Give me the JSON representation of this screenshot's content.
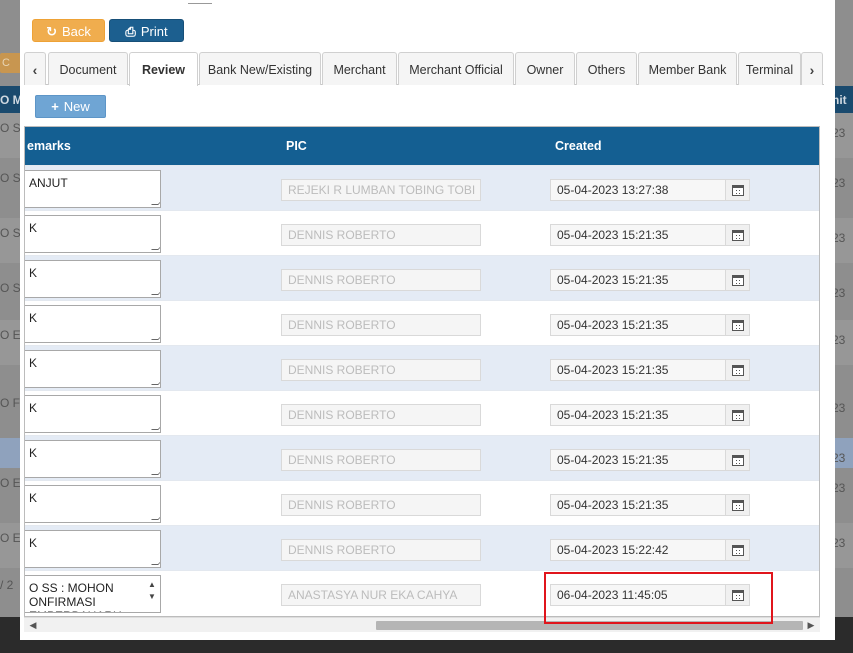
{
  "background": {
    "header_left": "O M",
    "header_right": "nit",
    "orange_btn": "C",
    "left_cells": [
      "O S",
      "O S",
      "O S",
      "O S",
      "O E",
      "O F",
      "",
      "O E",
      "O E"
    ],
    "right_cells": [
      "23",
      "23",
      "23",
      "23",
      "23",
      "23",
      "23",
      "23",
      "23"
    ],
    "pager": "/ 2"
  },
  "toolbar": {
    "back_label": "Back",
    "back_icon": "↻",
    "print_label": "Print",
    "print_icon": "⎙"
  },
  "tabs": {
    "prev_icon": "‹",
    "next_icon": "›",
    "items": [
      {
        "label": "Document",
        "active": false
      },
      {
        "label": "Review",
        "active": true
      },
      {
        "label": "Bank New/Existing",
        "active": false
      },
      {
        "label": "Merchant",
        "active": false
      },
      {
        "label": "Merchant Official",
        "active": false
      },
      {
        "label": "Owner",
        "active": false
      },
      {
        "label": "Others",
        "active": false
      },
      {
        "label": "Member Bank",
        "active": false
      },
      {
        "label": "Terminal",
        "active": false
      }
    ]
  },
  "new_button": {
    "icon": "+",
    "label": "New"
  },
  "grid": {
    "columns": {
      "remarks": "emarks",
      "pic": "PIC",
      "created": "Created"
    },
    "rows": [
      {
        "remark": "ANJUT",
        "pic": "REJEKI R LUMBAN TOBING TOBI",
        "created": "05-04-2023 13:27:38"
      },
      {
        "remark": "K",
        "pic": "DENNIS ROBERTO",
        "created": "05-04-2023 15:21:35"
      },
      {
        "remark": "K",
        "pic": "DENNIS ROBERTO",
        "created": "05-04-2023 15:21:35"
      },
      {
        "remark": "K",
        "pic": "DENNIS ROBERTO",
        "created": "05-04-2023 15:21:35"
      },
      {
        "remark": "K",
        "pic": "DENNIS ROBERTO",
        "created": "05-04-2023 15:21:35"
      },
      {
        "remark": "K",
        "pic": "DENNIS ROBERTO",
        "created": "05-04-2023 15:21:35"
      },
      {
        "remark": "K",
        "pic": "DENNIS ROBERTO",
        "created": "05-04-2023 15:21:35"
      },
      {
        "remark": "K",
        "pic": "DENNIS ROBERTO",
        "created": "05-04-2023 15:21:35"
      },
      {
        "remark": "K",
        "pic": "DENNIS ROBERTO",
        "created": "05-04-2023 15:22:42"
      },
      {
        "remark": "O SS : MOHON\nONFIRMASI\nEMPERBAHARU",
        "pic": "ANASTASYA NUR EKA CAHYA",
        "created": "06-04-2023 11:45:05"
      }
    ]
  },
  "colors": {
    "header_bg": "#145f92",
    "row_alt": "#e4ebf5",
    "back_btn": "#f0ad4e",
    "print_btn": "#1c5f8f",
    "new_btn": "#6fa5d4",
    "highlight": "#e0151c"
  }
}
